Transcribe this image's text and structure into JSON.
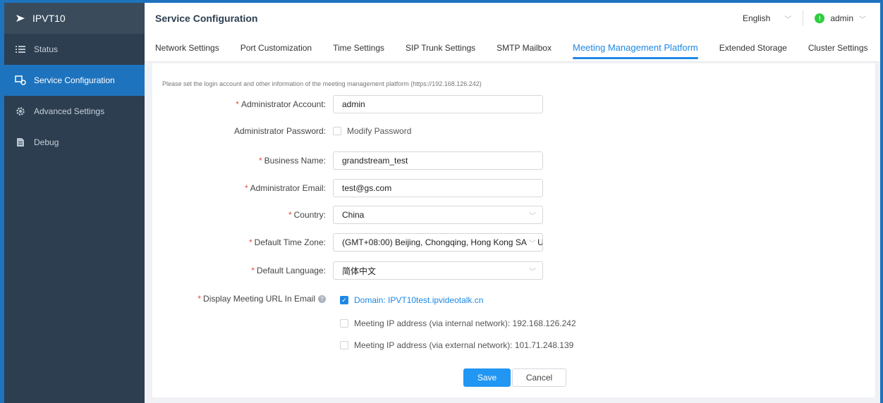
{
  "app": {
    "name": "IPVT10"
  },
  "sidebar": {
    "items": [
      {
        "label": "Status",
        "icon": "list-icon"
      },
      {
        "label": "Service Configuration",
        "icon": "service-config-icon"
      },
      {
        "label": "Advanced Settings",
        "icon": "gear-icon"
      },
      {
        "label": "Debug",
        "icon": "document-icon"
      }
    ],
    "active_index": 1
  },
  "header": {
    "title": "Service Configuration",
    "language": "English",
    "user": "admin"
  },
  "tabs": [
    {
      "label": "Network Settings"
    },
    {
      "label": "Port Customization"
    },
    {
      "label": "Time Settings"
    },
    {
      "label": "SIP Trunk Settings"
    },
    {
      "label": "SMTP Mailbox"
    },
    {
      "label": "Meeting Management Platform"
    },
    {
      "label": "Extended Storage"
    },
    {
      "label": "Cluster Settings"
    }
  ],
  "active_tab": 5,
  "form": {
    "hint": "Please set the login account and other information of the meeting management platform (https://192.168.126.242)",
    "admin_account": {
      "label": "Administrator Account:",
      "value": "admin"
    },
    "admin_password": {
      "label": "Administrator Password:",
      "option": "Modify Password"
    },
    "business_name": {
      "label": "Business Name:",
      "value": "grandstream_test"
    },
    "admin_email": {
      "label": "Administrator Email:",
      "value": "test@gs.com"
    },
    "country": {
      "label": "Country:",
      "value": "China"
    },
    "time_zone": {
      "label": "Default Time Zone:",
      "value": "(GMT+08:00) Beijing, Chongqing, Hong Kong SAR, U"
    },
    "language": {
      "label": "Default Language:",
      "value": "简体中文"
    },
    "display_url": {
      "label": "Display Meeting URL In Email",
      "options": [
        {
          "text": "Domain: IPVT10test.ipvideotalk.cn",
          "checked": true
        },
        {
          "text": "Meeting IP address (via internal network): 192.168.126.242",
          "checked": false
        },
        {
          "text": "Meeting IP address (via external network): 101.71.248.139",
          "checked": false
        }
      ]
    },
    "save_label": "Save",
    "cancel_label": "Cancel"
  },
  "colors": {
    "accent": "#1e88e5",
    "sidebar_bg": "#2c3e50",
    "required": "#e74c3c"
  }
}
